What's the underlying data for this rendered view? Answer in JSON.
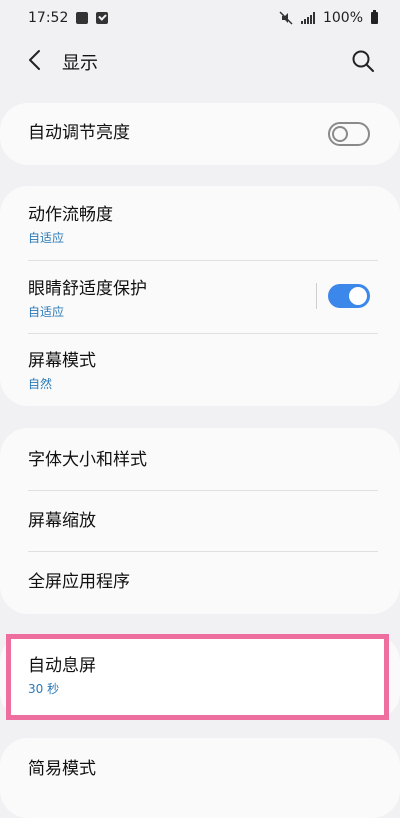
{
  "status_bar": {
    "time": "17:52",
    "battery": "100%"
  },
  "header": {
    "title": "显示"
  },
  "cards": {
    "brightness": {
      "title": "自动调节亮度",
      "toggle": "off"
    },
    "motion": {
      "title": "动作流畅度",
      "subtitle": "自适应"
    },
    "eye_comfort": {
      "title": "眼睛舒适度保护",
      "subtitle": "自适应",
      "toggle": "on"
    },
    "screen_mode": {
      "title": "屏幕模式",
      "subtitle": "自然"
    },
    "font": {
      "title": "字体大小和样式"
    },
    "zoom": {
      "title": "屏幕缩放"
    },
    "fullscreen_apps": {
      "title": "全屏应用程序"
    },
    "screen_timeout": {
      "title": "自动息屏",
      "subtitle": "30 秒"
    },
    "easy_mode": {
      "title": "简易模式"
    }
  },
  "colors": {
    "accent": "#3b87ea",
    "subtitle": "#2a7ab8",
    "highlight": "#ef6ea0"
  },
  "icons": [
    "image-icon",
    "check-icon",
    "mute-icon",
    "signal-icon",
    "battery-icon",
    "back-icon",
    "search-icon"
  ]
}
